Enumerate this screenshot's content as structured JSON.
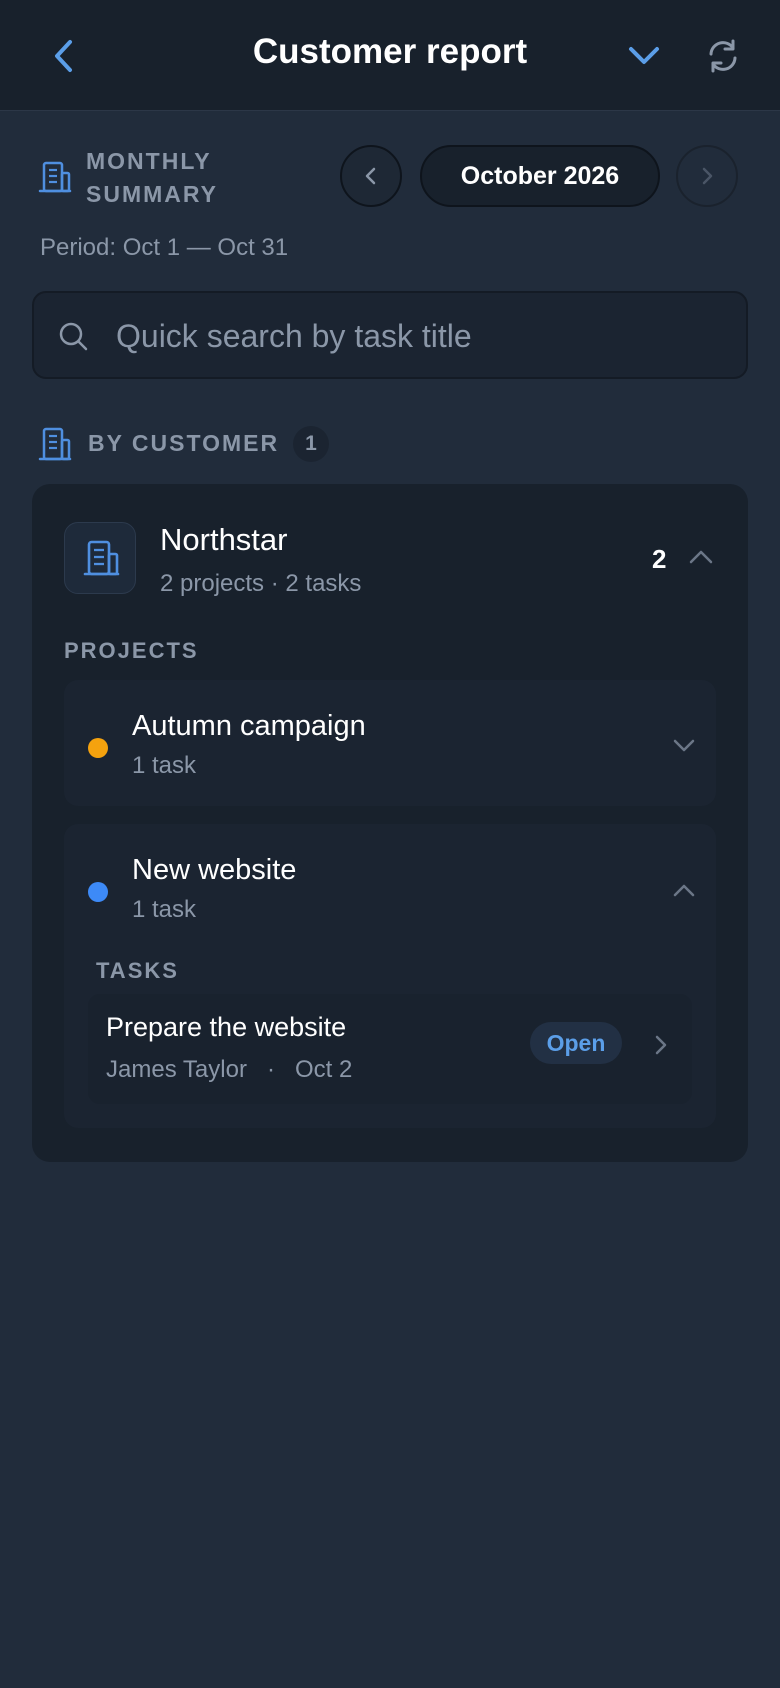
{
  "header": {
    "title": "Customer report",
    "back_icon": "chevron-left-icon",
    "dropdown_icon": "chevron-down-icon",
    "refresh_icon": "refresh-icon"
  },
  "summary": {
    "label": "MONTHLY SUMMARY",
    "icon": "building-icon",
    "month": "October 2026",
    "period": "Period: Oct 1 — Oct 31"
  },
  "search": {
    "placeholder": "Quick search by task title",
    "value": ""
  },
  "by_customer": {
    "label": "BY CUSTOMER",
    "count": "1"
  },
  "customers": [
    {
      "name": "Northstar",
      "meta": "2 projects · 2 tasks",
      "count": "2",
      "projects_label": "PROJECTS",
      "projects": [
        {
          "name": "Autumn campaign",
          "meta": "1 task",
          "color": "#f5a20e",
          "expanded": false
        },
        {
          "name": "New website",
          "meta": "1 task",
          "color": "#3d8af7",
          "expanded": true,
          "tasks_label": "TASKS",
          "tasks": [
            {
              "title": "Prepare the website",
              "meta": "James Taylor   ·   Oct 2",
              "status": "Open"
            }
          ]
        }
      ]
    }
  ],
  "colors": {
    "background": "#212c3b",
    "header": "#18212c",
    "accent": "#5b9ee8",
    "muted_text": "#8b97a8"
  }
}
